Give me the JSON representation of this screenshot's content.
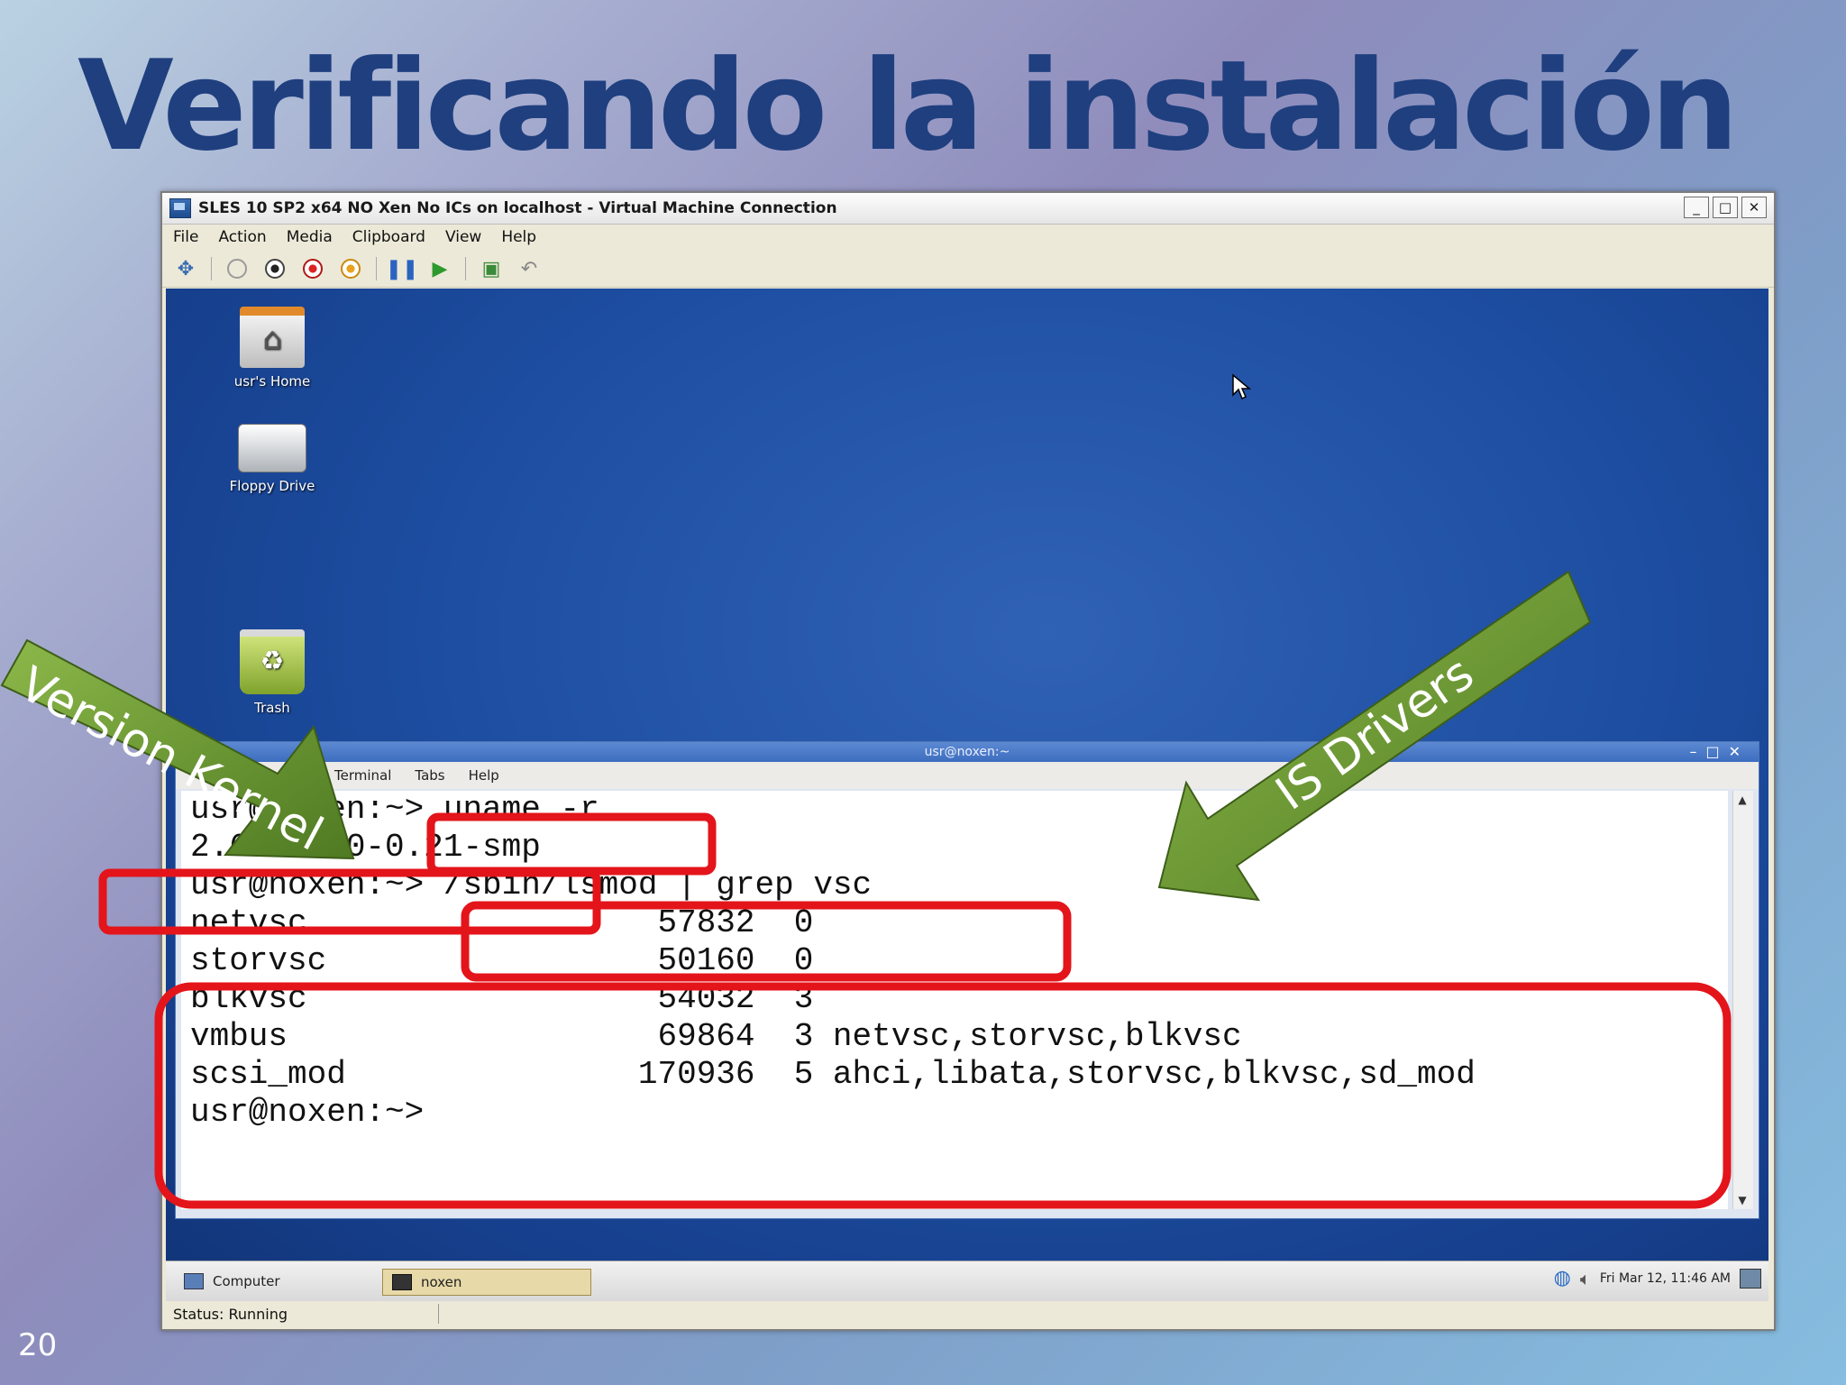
{
  "slide": {
    "title": "Verificando la instalación",
    "page_number": "20"
  },
  "vm_window": {
    "title": "SLES 10 SP2 x64 NO Xen No ICs on localhost - Virtual Machine Connection",
    "menu": [
      "File",
      "Action",
      "Media",
      "Clipboard",
      "View",
      "Help"
    ],
    "status": "Status: Running"
  },
  "desktop": {
    "icons": [
      {
        "label": "usr's Home"
      },
      {
        "label": "Floppy Drive"
      },
      {
        "label": "Trash"
      }
    ]
  },
  "terminal": {
    "title": "usr@noxen:~",
    "menu": [
      "Terminal",
      "Tabs",
      "Help"
    ],
    "lines": [
      "usr@noxen:~> uname -r",
      "2.6.16.60-0.21-smp",
      "usr@noxen:~> /sbin/lsmod | grep vsc",
      "netvsc                  57832  0",
      "storvsc                 50160  0",
      "blkvsc                  54032  3",
      "vmbus                   69864  3 netvsc,storvsc,blkvsc",
      "scsi_mod               170936  5 ahci,libata,storvsc,blkvsc,sd_mod",
      "usr@noxen:~>"
    ]
  },
  "guest_panel": {
    "computer_label": "Computer",
    "task_label": "noxen",
    "clock": "Fri Mar 12, 11:46 AM"
  },
  "annotations": {
    "left_arrow": "Version Kernel",
    "right_arrow": "IS Drivers",
    "highlight_color": "#e4141b",
    "arrow_color": "#6c9a2e"
  }
}
